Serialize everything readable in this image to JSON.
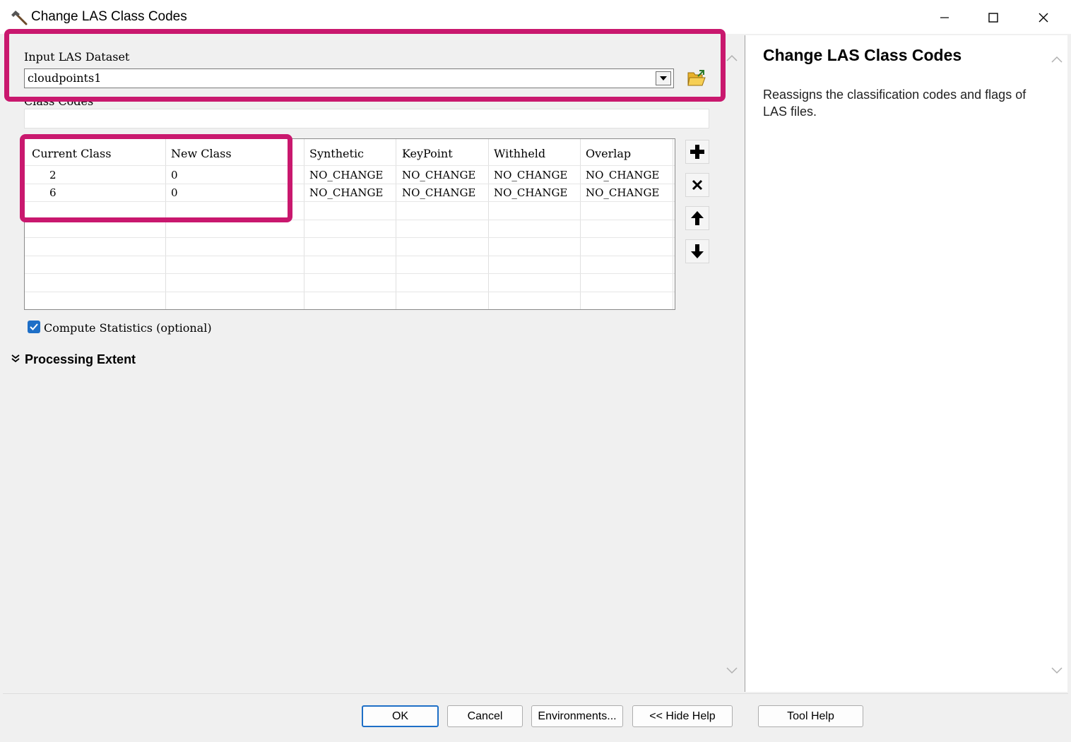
{
  "window": {
    "title": "Change LAS Class Codes"
  },
  "form": {
    "input_label": "Input LAS Dataset",
    "input_value": "cloudpoints1",
    "class_codes_label": "Class Codes",
    "grid": {
      "columns": [
        "Current Class",
        "New Class",
        "Synthetic",
        "KeyPoint",
        "Withheld",
        "Overlap"
      ],
      "rows": [
        [
          "2",
          "0",
          "NO_CHANGE",
          "NO_CHANGE",
          "NO_CHANGE",
          "NO_CHANGE"
        ],
        [
          "6",
          "0",
          "NO_CHANGE",
          "NO_CHANGE",
          "NO_CHANGE",
          "NO_CHANGE"
        ]
      ]
    },
    "compute_stats_label": "Compute Statistics (optional)",
    "compute_stats_checked": true,
    "processing_extent_label": "Processing Extent"
  },
  "help": {
    "title": "Change LAS Class Codes",
    "description": "Reassigns the classification codes and flags of LAS files."
  },
  "buttons": {
    "ok": "OK",
    "cancel": "Cancel",
    "environments": "Environments...",
    "hide_help": "<< Hide Help",
    "tool_help": "Tool Help"
  },
  "colors": {
    "highlight": "#c9186e",
    "checkbox": "#1e6fc7"
  }
}
